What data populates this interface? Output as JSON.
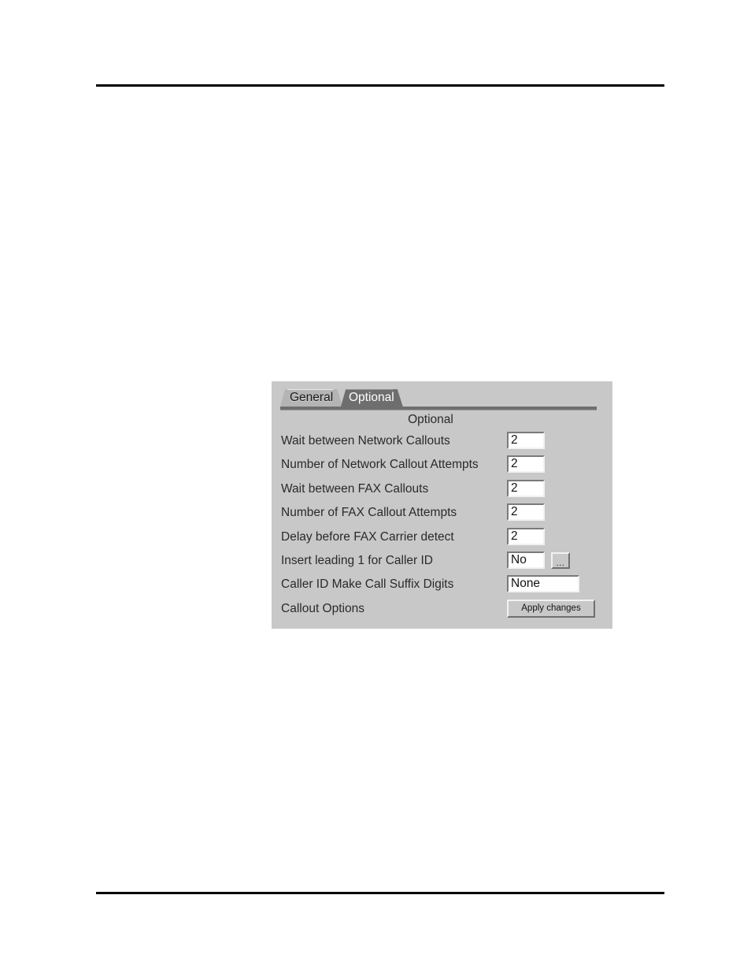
{
  "page": {
    "header_rule": "",
    "footer_rule": ""
  },
  "dialog": {
    "tabs": [
      {
        "label": "General",
        "selected": false
      },
      {
        "label": "Optional",
        "selected": true
      }
    ],
    "heading": "Optional",
    "rows": [
      {
        "label": "Wait between Network Callouts",
        "value": "2",
        "control": "textfield-narrow"
      },
      {
        "label": "Number of Network Callout Attempts",
        "value": "2",
        "control": "textfield-narrow"
      },
      {
        "label": "Wait between FAX Callouts",
        "value": "2",
        "control": "textfield-narrow"
      },
      {
        "label": "Number of FAX Callout Attempts",
        "value": "2",
        "control": "textfield-narrow"
      },
      {
        "label": "Delay before FAX Carrier detect",
        "value": "2",
        "control": "textfield-narrow"
      },
      {
        "label": "Insert leading 1 for Caller ID",
        "value": "No",
        "control": "textfield-with-browse"
      },
      {
        "label": "Caller ID Make Call Suffix Digits",
        "value": "None",
        "control": "textfield-wide"
      },
      {
        "label": "Callout Options",
        "value": "",
        "control": "push-button"
      }
    ],
    "browse_button_label": "...",
    "apply_button_label": "Apply changes",
    "colors": {
      "panel_background": "#c8c8c8",
      "tab_active_background": "#6e6e6e",
      "tab_active_text": "#ffffff",
      "tab_inactive_background": "#b4b4b4",
      "tab_inactive_text": "#1a1a1a",
      "field_background": "#ffffff",
      "text": "#2a2a2a",
      "rule": "#000000"
    }
  }
}
